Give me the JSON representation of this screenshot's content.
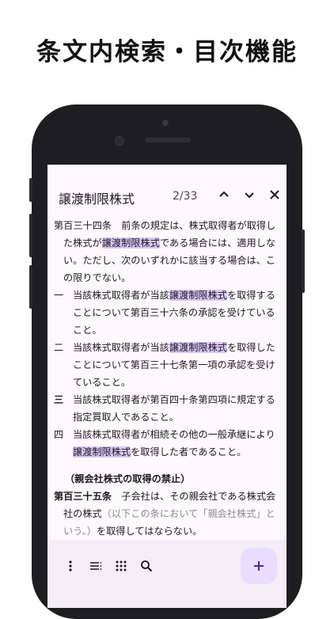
{
  "headline": "条文内検索・目次機能",
  "search": {
    "term": "譲渡制限株式",
    "counter": "2/33"
  },
  "icons": {
    "up": "chevron-up-icon",
    "down": "chevron-down-icon",
    "close": "close-icon",
    "menu": "more-vertical-icon",
    "list": "list-icon",
    "grid": "grid-icon",
    "search": "search-icon",
    "add": "plus-icon"
  },
  "colors": {
    "highlight": "#d9c6f7",
    "screen_bg": "#fdf8fd",
    "bottom_bar": "#f3edf7",
    "fab": "#e8ddff",
    "accent": "#4b2a8a"
  },
  "article134": {
    "title": "第百三十四条",
    "text_a": "　前条の規定は、株式取得者が取得した株式が",
    "hl": "譲渡制限株式",
    "text_b": "である場合には、適用しない。ただし、次のいずれかに該当する場合は、この限りでない。",
    "items": [
      {
        "num": "一",
        "a": "当該株式取得者が当該",
        "hl": "譲渡制限株式",
        "b": "を取得することについて第百三十六条の承認を受けていること。"
      },
      {
        "num": "二",
        "a": "当該株式取得者が当該",
        "hl": "譲渡制限株式",
        "b": "を取得したことについて第百三十七条第一項の承認を受けていること。"
      },
      {
        "num": "三",
        "a": "当該株式取得者が第百四十条第四項に規定する指定買取人であること。",
        "hl": "",
        "b": ""
      },
      {
        "num": "四",
        "a": "当該株式取得者が相続その他の一般承継により",
        "hl": "譲渡制限株式",
        "b": "を取得した者であること。"
      }
    ]
  },
  "article135": {
    "caption": "（親会社株式の取得の禁止）",
    "title": "第百三十五条",
    "text_a": "　子会社は、その親会社である株式会社の株式",
    "note": "（以下この条において「親会社株式」という。）",
    "text_b": "を取得してはならない。"
  }
}
